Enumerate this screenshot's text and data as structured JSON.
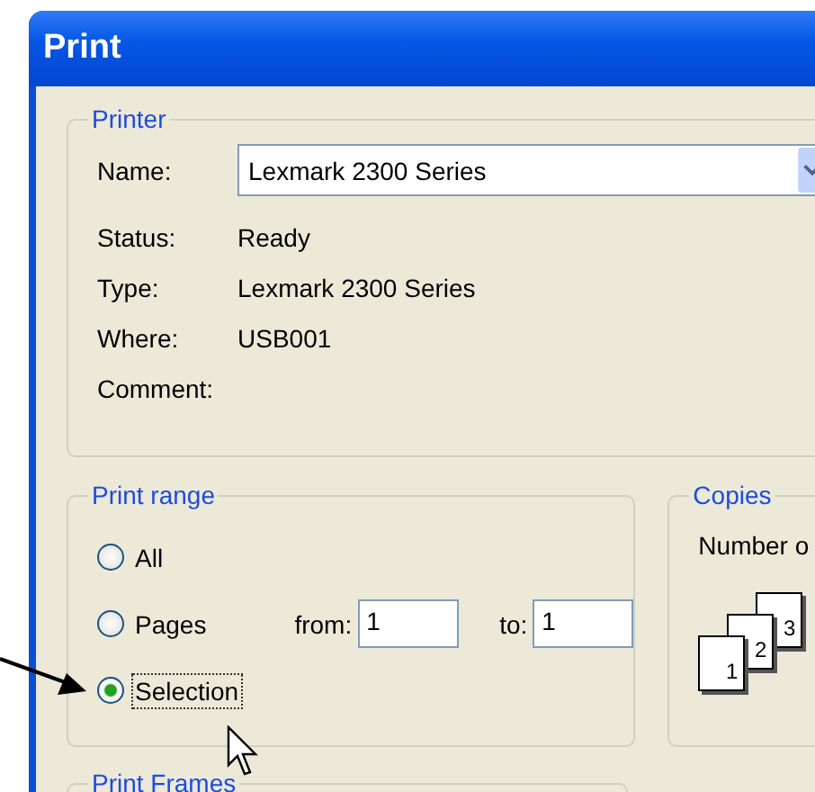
{
  "window": {
    "title": "Print"
  },
  "printer": {
    "legend": "Printer",
    "name_label": "Name:",
    "name_value": "Lexmark 2300 Series",
    "fields": [
      {
        "label": "Status:",
        "value": "Ready"
      },
      {
        "label": "Type:",
        "value": "Lexmark 2300 Series"
      },
      {
        "label": "Where:",
        "value": "USB001"
      },
      {
        "label": "Comment:"
      }
    ]
  },
  "print_range": {
    "legend": "Print range",
    "options": [
      {
        "label": "All",
        "selected": false,
        "focused": false
      },
      {
        "label": "Pages",
        "selected": false,
        "focused": false,
        "from": {
          "label": "from:",
          "value": "1"
        },
        "to": {
          "label": "to:",
          "value": "1"
        }
      },
      {
        "label": "Selection",
        "selected": true,
        "focused": true
      }
    ]
  },
  "copies": {
    "legend": "Copies",
    "number_label": "Number o",
    "collate_pages": [
      "1",
      "2",
      "3"
    ]
  },
  "print_frames": {
    "legend": "Print Frames"
  }
}
